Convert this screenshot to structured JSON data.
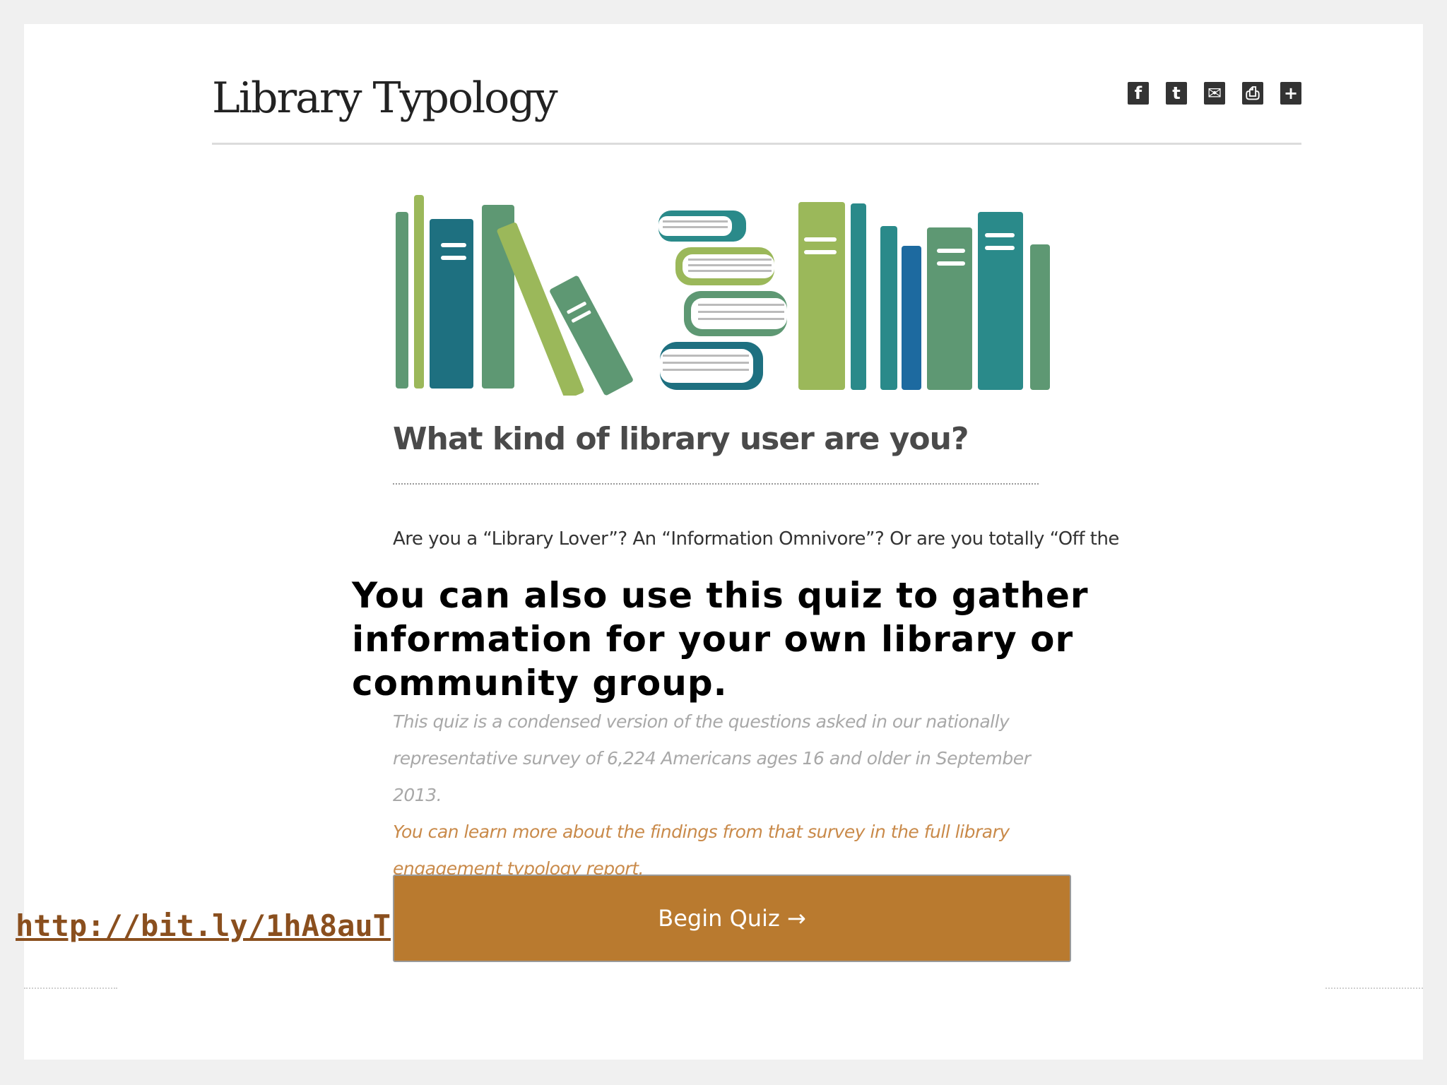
{
  "header": {
    "title": "Library Typology",
    "share_icons": [
      {
        "name": "facebook-icon",
        "glyph": "f"
      },
      {
        "name": "tumblr-icon",
        "glyph": "t"
      },
      {
        "name": "email-icon",
        "glyph": "✉"
      },
      {
        "name": "print-icon",
        "glyph": "⎙"
      },
      {
        "name": "add-icon",
        "glyph": "+"
      }
    ]
  },
  "quiz": {
    "heading": "What kind of library user are you?",
    "intro": "Are you a “Library Lover”? An “Information Omnivore”? Or are you totally “Off the",
    "note_lines": [
      "This quiz is a condensed version of the questions asked in our nationally",
      "representative survey of 6,224 Americans ages 16 and older in September 2013.",
      "You can learn more about the findings from that survey in the full library",
      "engagement typology report."
    ],
    "begin_label": "Begin Quiz →"
  },
  "overlay": {
    "caption": "You can also use this quiz to gather information for your own library or community group."
  },
  "link": {
    "text": "http://bit.ly/1hA8auT"
  },
  "colors": {
    "button": "#b97a2f",
    "link": "#8a4f1e"
  }
}
